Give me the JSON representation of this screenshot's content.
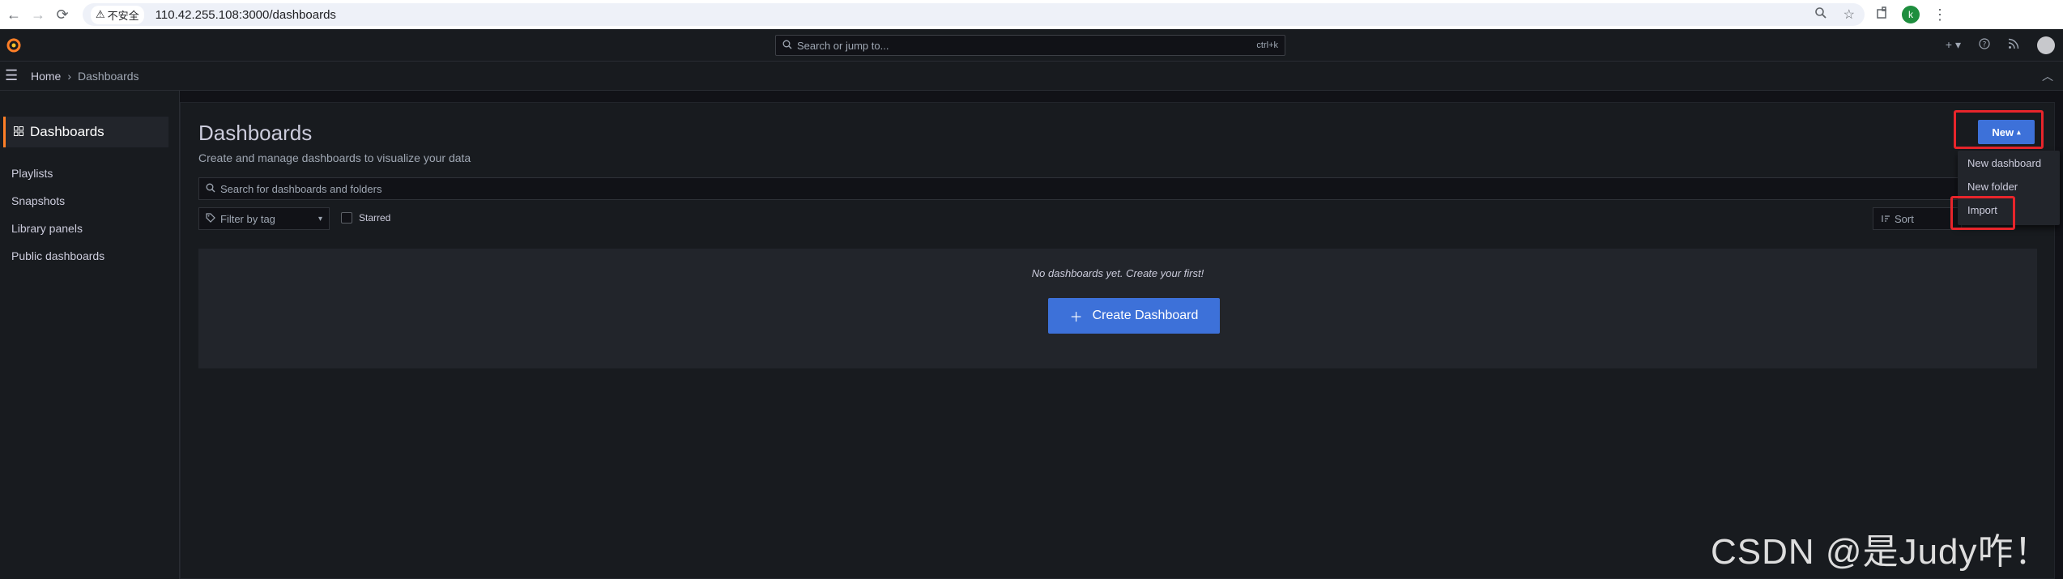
{
  "browser": {
    "back": "←",
    "forward": "→",
    "reload": "⟳",
    "insecure_label": "不安全",
    "url": "110.42.255.108:3000/dashboards",
    "profile_initial": "k"
  },
  "topbar": {
    "search_placeholder": "Search or jump to...",
    "search_shortcut": "ctrl+k",
    "add_label": "+ ▾"
  },
  "breadcrumb": {
    "home": "Home",
    "separator": "›",
    "current": "Dashboards"
  },
  "sidenav": {
    "header": "Dashboards",
    "items": [
      {
        "label": "Playlists"
      },
      {
        "label": "Snapshots"
      },
      {
        "label": "Library panels"
      },
      {
        "label": "Public dashboards"
      }
    ]
  },
  "main": {
    "title": "Dashboards",
    "subtitle": "Create and manage dashboards to visualize your data",
    "search_placeholder": "Search for dashboards and folders",
    "tag_filter_placeholder": "Filter by tag",
    "starred_label": "Starred",
    "sort_label": "Sort",
    "empty_message": "No dashboards yet. Create your first!",
    "create_button": "Create Dashboard",
    "new_button": "New",
    "new_menu": [
      {
        "label": "New dashboard"
      },
      {
        "label": "New folder"
      },
      {
        "label": "Import"
      }
    ]
  },
  "watermark": "CSDN @是Judy咋！",
  "colors": {
    "accent_blue": "#3d71d9",
    "highlight_red": "#e8252b",
    "brand_orange": "#ff7f27"
  }
}
